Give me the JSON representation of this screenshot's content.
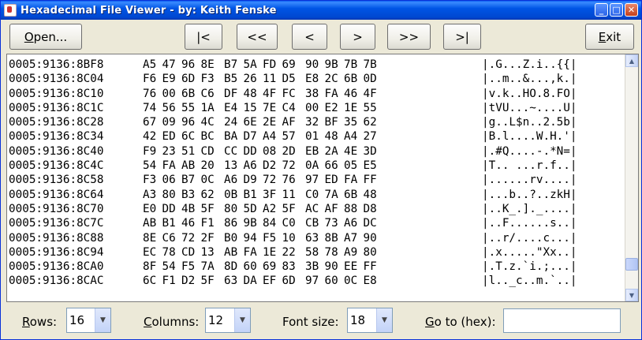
{
  "window": {
    "title": "Hexadecimal File Viewer - by: Keith Fenske"
  },
  "toolbar": {
    "open_label_key": "O",
    "open_label_rest": "pen...",
    "first_label": "|<",
    "fast_back_label": "<<",
    "back_label": "<",
    "forward_label": ">",
    "fast_forward_label": ">>",
    "last_label": ">|",
    "exit_label_key": "E",
    "exit_label_rest": "xit"
  },
  "rows": [
    {
      "addr": "0005:9136:8BF8",
      "bytes": [
        "A5",
        "47",
        "96",
        "8E",
        "B7",
        "5A",
        "FD",
        "69",
        "90",
        "9B",
        "7B",
        "7B"
      ],
      "ascii": "|.G...Z.i..{{|"
    },
    {
      "addr": "0005:9136:8C04",
      "bytes": [
        "F6",
        "E9",
        "6D",
        "F3",
        "B5",
        "26",
        "11",
        "D5",
        "E8",
        "2C",
        "6B",
        "0D"
      ],
      "ascii": "|..m..&...,k.|"
    },
    {
      "addr": "0005:9136:8C10",
      "bytes": [
        "76",
        "00",
        "6B",
        "C6",
        "DF",
        "48",
        "4F",
        "FC",
        "38",
        "FA",
        "46",
        "4F"
      ],
      "ascii": "|v.k..HO.8.FO|"
    },
    {
      "addr": "0005:9136:8C1C",
      "bytes": [
        "74",
        "56",
        "55",
        "1A",
        "E4",
        "15",
        "7E",
        "C4",
        "00",
        "E2",
        "1E",
        "55"
      ],
      "ascii": "|tVU...~....U|"
    },
    {
      "addr": "0005:9136:8C28",
      "bytes": [
        "67",
        "09",
        "96",
        "4C",
        "24",
        "6E",
        "2E",
        "AF",
        "32",
        "BF",
        "35",
        "62"
      ],
      "ascii": "|g..L$n..2.5b|"
    },
    {
      "addr": "0005:9136:8C34",
      "bytes": [
        "42",
        "ED",
        "6C",
        "BC",
        "BA",
        "D7",
        "A4",
        "57",
        "01",
        "48",
        "A4",
        "27"
      ],
      "ascii": "|B.l....W.H.'|"
    },
    {
      "addr": "0005:9136:8C40",
      "bytes": [
        "F9",
        "23",
        "51",
        "CD",
        "CC",
        "DD",
        "08",
        "2D",
        "EB",
        "2A",
        "4E",
        "3D"
      ],
      "ascii": "|.#Q....-.*N=|"
    },
    {
      "addr": "0005:9136:8C4C",
      "bytes": [
        "54",
        "FA",
        "AB",
        "20",
        "13",
        "A6",
        "D2",
        "72",
        "0A",
        "66",
        "05",
        "E5"
      ],
      "ascii": "|T.. ...r.f..|"
    },
    {
      "addr": "0005:9136:8C58",
      "bytes": [
        "F3",
        "06",
        "B7",
        "0C",
        "A6",
        "D9",
        "72",
        "76",
        "97",
        "ED",
        "FA",
        "FF"
      ],
      "ascii": "|......rv....|"
    },
    {
      "addr": "0005:9136:8C64",
      "bytes": [
        "A3",
        "80",
        "B3",
        "62",
        "0B",
        "B1",
        "3F",
        "11",
        "C0",
        "7A",
        "6B",
        "48"
      ],
      "ascii": "|...b..?..zkH|"
    },
    {
      "addr": "0005:9136:8C70",
      "bytes": [
        "E0",
        "DD",
        "4B",
        "5F",
        "80",
        "5D",
        "A2",
        "5F",
        "AC",
        "AF",
        "88",
        "D8"
      ],
      "ascii": "|..K_.]._....|"
    },
    {
      "addr": "0005:9136:8C7C",
      "bytes": [
        "AB",
        "B1",
        "46",
        "F1",
        "86",
        "9B",
        "84",
        "C0",
        "CB",
        "73",
        "A6",
        "DC"
      ],
      "ascii": "|..F......s..|"
    },
    {
      "addr": "0005:9136:8C88",
      "bytes": [
        "8E",
        "C6",
        "72",
        "2F",
        "B0",
        "94",
        "F5",
        "10",
        "63",
        "8B",
        "A7",
        "90"
      ],
      "ascii": "|..r/....c...|"
    },
    {
      "addr": "0005:9136:8C94",
      "bytes": [
        "EC",
        "78",
        "CD",
        "13",
        "AB",
        "FA",
        "1E",
        "22",
        "58",
        "78",
        "A9",
        "80"
      ],
      "ascii": "|.x.....\"Xx..|"
    },
    {
      "addr": "0005:9136:8CA0",
      "bytes": [
        "8F",
        "54",
        "F5",
        "7A",
        "8D",
        "60",
        "69",
        "83",
        "3B",
        "90",
        "EE",
        "FF"
      ],
      "ascii": "|.T.z.`i.;...|"
    },
    {
      "addr": "0005:9136:8CAC",
      "bytes": [
        "6C",
        "F1",
        "D2",
        "5F",
        "63",
        "DA",
        "EF",
        "6D",
        "97",
        "60",
        "0C",
        "E8"
      ],
      "ascii": "|l.._c..m.`..|"
    }
  ],
  "footer": {
    "rows_label_key": "R",
    "rows_label_rest": "ows:",
    "rows_value": "16",
    "columns_label_key": "C",
    "columns_label_rest": "olumns:",
    "columns_value": "12",
    "font_size_label": "Font size:",
    "font_size_value": "18",
    "goto_label_key": "G",
    "goto_label_rest": "o to (hex):",
    "goto_value": ""
  },
  "colors": {
    "titlebar": "#0055e5",
    "window_bg": "#ece9d8",
    "viewer_bg": "#ffffff"
  }
}
